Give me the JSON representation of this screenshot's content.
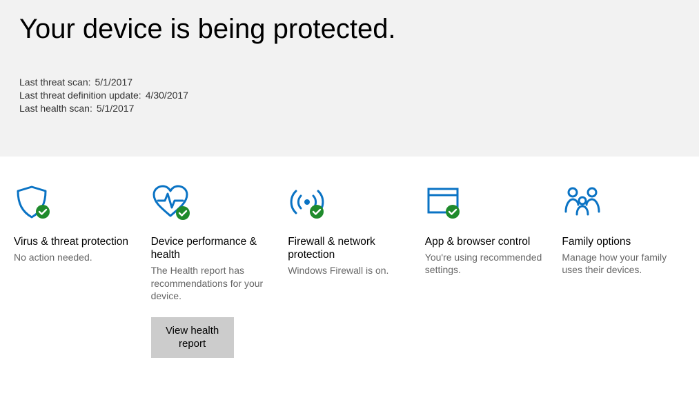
{
  "header": {
    "title": "Your device is being protected.",
    "status": [
      {
        "label": "Last threat scan:",
        "value": "5/1/2017"
      },
      {
        "label": "Last threat definition update:",
        "value": "4/30/2017"
      },
      {
        "label": "Last health scan:",
        "value": "5/1/2017"
      }
    ]
  },
  "cards": {
    "virus": {
      "title": "Virus & threat protection",
      "desc": "No action needed."
    },
    "health": {
      "title": "Device performance & health",
      "desc": "The Health report has recommendations for your device.",
      "button": "View health report"
    },
    "firewall": {
      "title": "Firewall & network protection",
      "desc": "Windows Firewall is on."
    },
    "app": {
      "title": "App & browser control",
      "desc": "You're using recommended settings."
    },
    "family": {
      "title": "Family options",
      "desc": "Manage how your family uses their devices."
    }
  },
  "colors": {
    "accent": "#0a73c4",
    "ok": "#1f8b2c"
  }
}
